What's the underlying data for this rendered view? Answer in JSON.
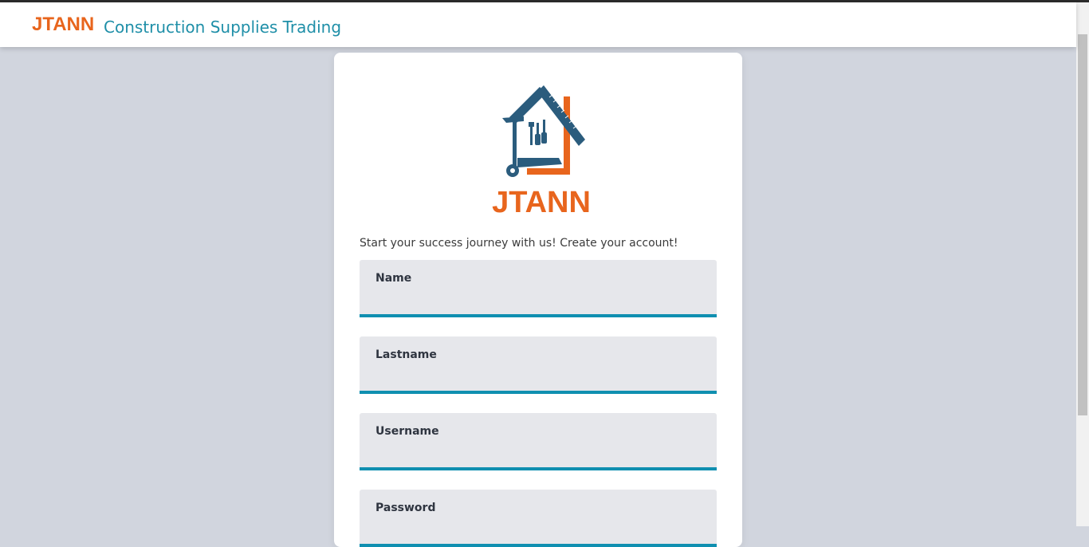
{
  "header": {
    "brand": "JTANN",
    "subtitle": "Construction Supplies Trading"
  },
  "logo": {
    "text": "JTANN",
    "colors": {
      "blue": "#2b5c7d",
      "orange": "#e8651d"
    }
  },
  "form": {
    "tagline": "Start your success journey with us! Create your account!",
    "fields": [
      {
        "label": "Name",
        "value": ""
      },
      {
        "label": "Lastname",
        "value": ""
      },
      {
        "label": "Username",
        "value": ""
      },
      {
        "label": "Password",
        "value": ""
      }
    ]
  },
  "colors": {
    "accent": "#0f8fb0",
    "brand": "#e8651d",
    "subtitle": "#1f8fa8",
    "background": "#d1d5de"
  }
}
